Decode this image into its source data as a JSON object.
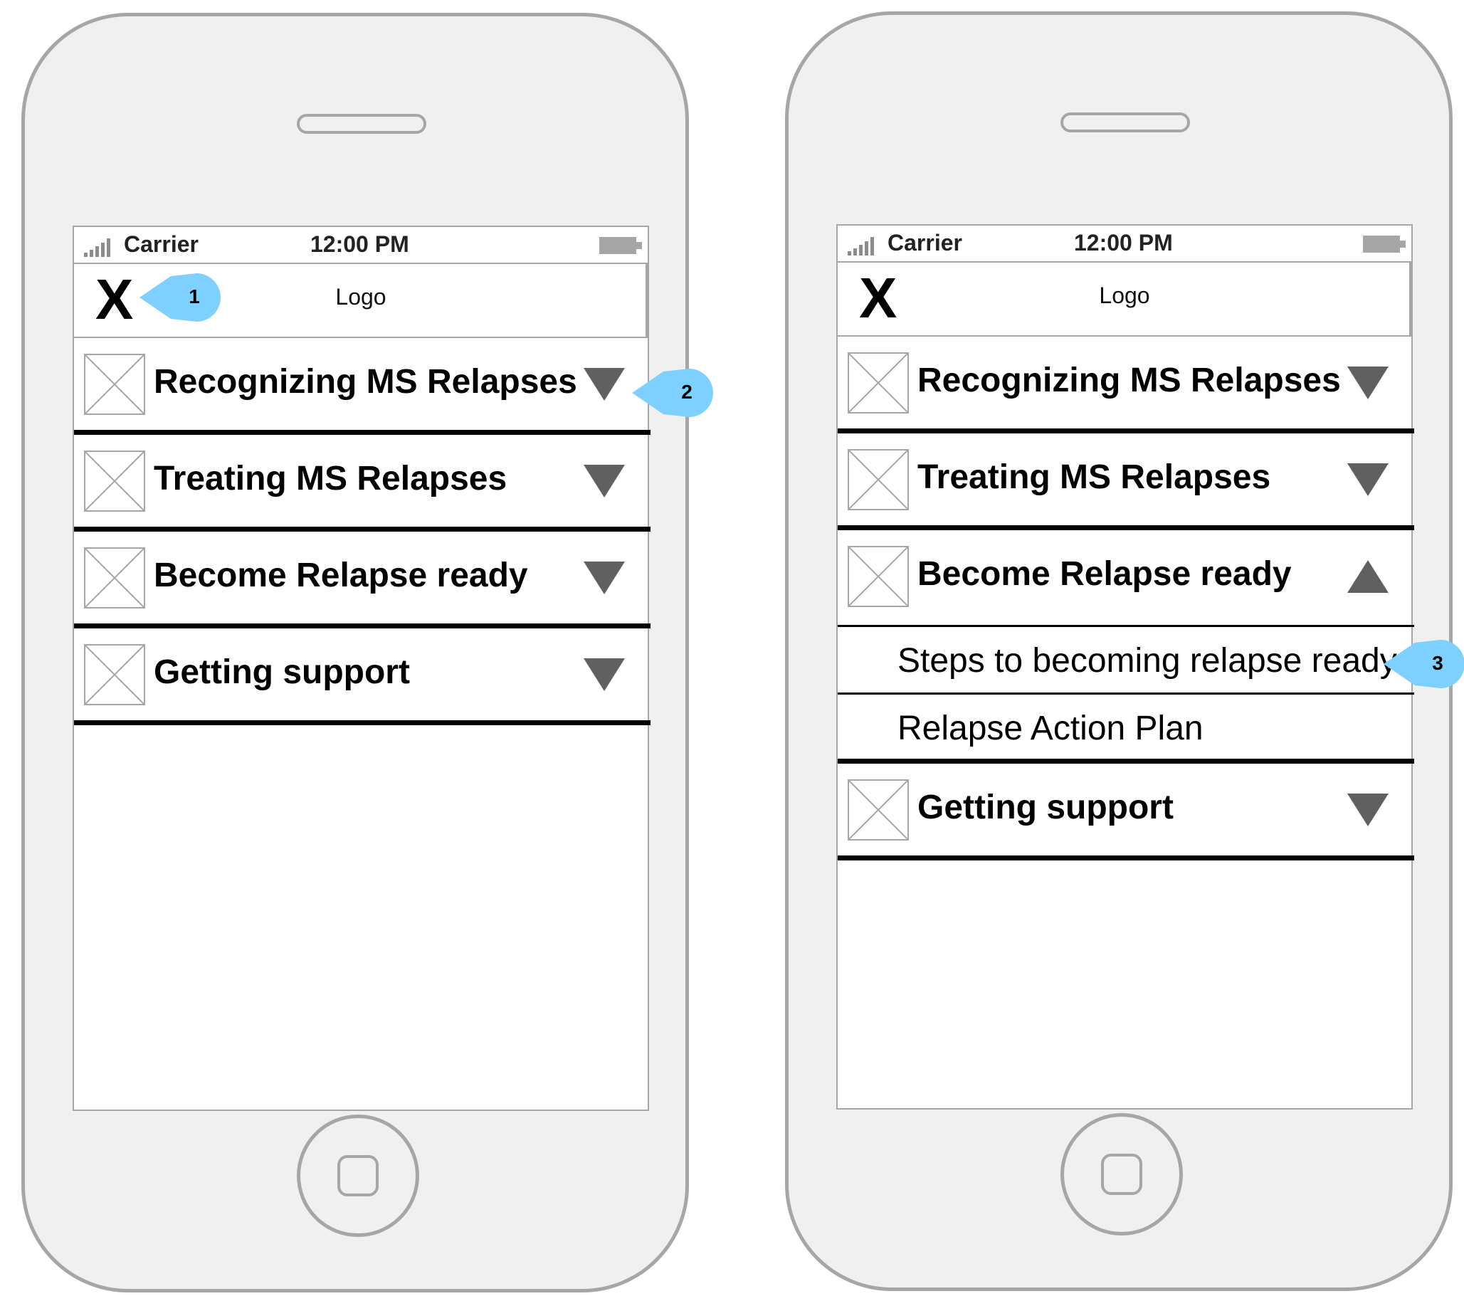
{
  "colors": {
    "frame": "#a6a6a6",
    "phone_body": "#f0f0f0",
    "callout": "#7ed0ff",
    "chevron": "#606060",
    "divider": "#000000"
  },
  "status_bar": {
    "carrier": "Carrier",
    "time": "12:00 PM"
  },
  "header": {
    "close_icon": "X",
    "logo": "Logo"
  },
  "callouts": [
    "1",
    "2",
    "3"
  ],
  "screens": [
    {
      "items": [
        {
          "label": "Recognizing MS Relapses",
          "icon": "chevron-down-icon"
        },
        {
          "label": "Treating MS Relapses",
          "icon": "chevron-down-icon"
        },
        {
          "label": "Become Relapse ready",
          "icon": "chevron-down-icon"
        },
        {
          "label": "Getting support",
          "icon": "chevron-down-icon"
        }
      ]
    },
    {
      "items": [
        {
          "label": "Recognizing MS Relapses",
          "icon": "chevron-down-icon"
        },
        {
          "label": "Treating MS Relapses",
          "icon": "chevron-down-icon"
        },
        {
          "label": "Become Relapse ready",
          "icon": "chevron-up-icon",
          "expanded": true,
          "subitems": [
            "Steps to becoming relapse ready",
            "Relapse Action Plan"
          ]
        },
        {
          "label": "Getting support",
          "icon": "chevron-down-icon"
        }
      ]
    }
  ]
}
